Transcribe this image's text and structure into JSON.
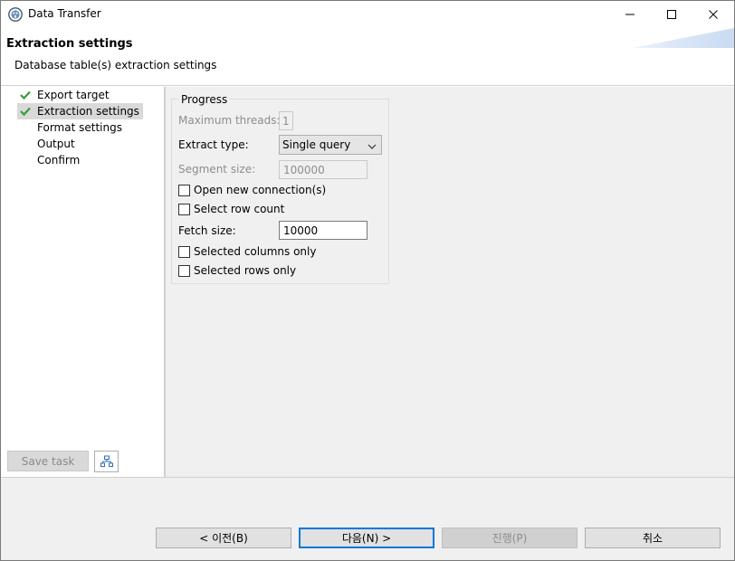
{
  "window": {
    "title": "Data Transfer"
  },
  "banner": {
    "title": "Extraction settings",
    "subtitle": "Database table(s) extraction settings"
  },
  "nav": {
    "items": [
      {
        "label": "Export target",
        "done": true,
        "selected": false
      },
      {
        "label": "Extraction settings",
        "done": true,
        "selected": true
      },
      {
        "label": "Format settings",
        "done": false,
        "selected": false
      },
      {
        "label": "Output",
        "done": false,
        "selected": false
      },
      {
        "label": "Confirm",
        "done": false,
        "selected": false
      }
    ],
    "save_task_label": "Save task"
  },
  "progress": {
    "group_title": "Progress",
    "max_threads_label": "Maximum threads:",
    "max_threads_value": "1",
    "extract_type_label": "Extract type:",
    "extract_type_value": "Single query",
    "segment_size_label": "Segment size:",
    "segment_size_value": "100000",
    "open_new_connection_label": "Open new connection(s)",
    "select_row_count_label": "Select row count",
    "fetch_size_label": "Fetch size:",
    "fetch_size_value": "10000",
    "selected_columns_only_label": "Selected columns only",
    "selected_rows_only_label": "Selected rows only"
  },
  "footer": {
    "back_label": "< 이전(B)",
    "next_label": "다음(N) >",
    "proceed_label": "진행(P)",
    "cancel_label": "취소"
  },
  "colors": {
    "check_green": "#3a9a3a",
    "primary_border": "#0078d7"
  }
}
